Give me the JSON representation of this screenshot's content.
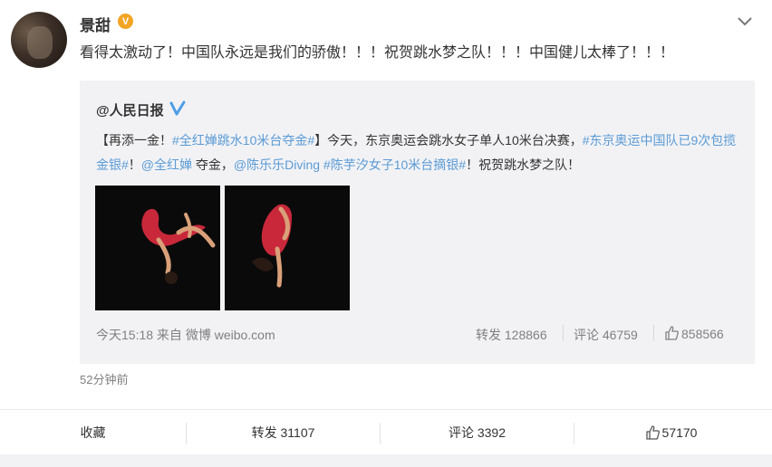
{
  "post": {
    "username": "景甜",
    "verified_badge": "V",
    "text": "看得太激动了！中国队永远是我们的骄傲！！！祝贺跳水梦之队！！！中国健儿太棒了！！！",
    "time_ago": "52分钟前"
  },
  "repost": {
    "username": "@人民日报",
    "text_parts": {
      "p1": "【再添一金！",
      "p2": "#全红婵跳水10米台夺金#",
      "p3": "】今天，东京奥运会跳水女子单人10米台决赛，",
      "p4": "#东京奥运中国队已9次包揽金银#",
      "p5": "！",
      "p6": "@全红婵",
      "p7": " 夺金，",
      "p8": "@陈乐乐Diving",
      "p9": " ",
      "p10": "#陈芋汐女子10米台摘银#",
      "p11": "！祝贺跳水梦之队！"
    },
    "timestamp": "今天15:18 来自 微博 weibo.com",
    "repost_label": "转发 128866",
    "comment_label": "评论 46759",
    "like_count": "858566"
  },
  "actions": {
    "favorite": "收藏",
    "repost": "转发 31107",
    "comment": "评论 3392",
    "like": "57170"
  },
  "colors": {
    "link": "#5b9bd5",
    "badge_orange": "#f2a524",
    "repost_bg": "#f2f2f5"
  }
}
